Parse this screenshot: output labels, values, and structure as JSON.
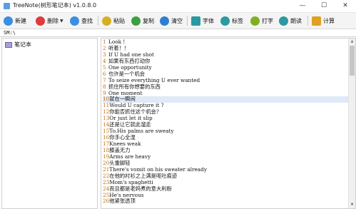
{
  "window": {
    "title": "TreeNote(树形笔记本) v1.0.8.0",
    "minimize_glyph": "—",
    "maximize_glyph": "☐",
    "close_glyph": "✕"
  },
  "toolbar": {
    "new_label": "新建",
    "delete_label": "删除",
    "dropdown_glyph": "▼",
    "find_label": "查找",
    "paste_label": "粘贴",
    "copy_label": "复制",
    "clear_label": "清空",
    "font_label": "字体",
    "tag_label": "标签",
    "type_label": "打字",
    "read_label": "朗读",
    "calc_label": "计算"
  },
  "path": "SM:\\",
  "tree": {
    "items": [
      {
        "label": "笔记本",
        "icon": "notebook-icon"
      }
    ]
  },
  "editor": {
    "selected_line": 10,
    "lines": [
      {
        "n": "1",
        "text": "Look !"
      },
      {
        "n": "2",
        "text": "听着！！"
      },
      {
        "n": "3",
        "text": "If U had one shot"
      },
      {
        "n": "4",
        "text": "如果有东西打动你"
      },
      {
        "n": "5",
        "text": "One opportunity"
      },
      {
        "n": "6",
        "text": "也许是一个机会"
      },
      {
        "n": "7",
        "text": "To seize everything U ever wanted"
      },
      {
        "n": "8",
        "text": "抓住所有你想要的东西"
      },
      {
        "n": "9",
        "text": "One moment"
      },
      {
        "n": "10",
        "text": "就在一瞬间"
      },
      {
        "n": "11",
        "text": "Would U capture it ?"
      },
      {
        "n": "12",
        "text": "你能否抓住这个机会?"
      },
      {
        "n": "13",
        "text": "Or just let it slip"
      },
      {
        "n": "14",
        "text": "还是让它就此溜走"
      },
      {
        "n": "15",
        "text": "To.His palms are sweaty"
      },
      {
        "n": "16",
        "text": "你手心全湿"
      },
      {
        "n": "17",
        "text": "Knees weak"
      },
      {
        "n": "18",
        "text": "膝盖无力"
      },
      {
        "n": "19",
        "text": "Arms are heavy"
      },
      {
        "n": "20",
        "text": "头重脚轻"
      },
      {
        "n": "21",
        "text": "There's vomit on his sweater already"
      },
      {
        "n": "22",
        "text": "在他的衬衫之上满是呕吐痕迹"
      },
      {
        "n": "23",
        "text": "Mom's spaghetti"
      },
      {
        "n": "24",
        "text": "而且都是老妈煮的意大利粉"
      },
      {
        "n": "25",
        "text": "He's nervous"
      },
      {
        "n": "26",
        "text": "他紧张透顶"
      }
    ]
  },
  "colors": {
    "new_icon": "#3a8fe0",
    "delete_icon": "#e03a3a",
    "find_icon": "#3a8fe0",
    "paste_icon": "#d4b020",
    "copy_icon": "#3aa040",
    "clear_icon": "#2f7fd0",
    "font_icon": "#2a9aa0",
    "tag_icon": "#2a9aa0",
    "type_icon": "#80b020",
    "read_icon": "#2a9aa0",
    "calc_icon": "#e0a020",
    "line_number": "#c07010",
    "selected_line_bg": "#dfe9f7"
  }
}
